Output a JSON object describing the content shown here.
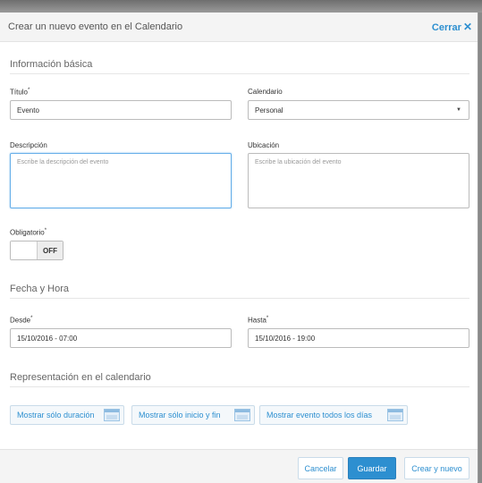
{
  "modal": {
    "title": "Crear un nuevo evento en el Calendario",
    "close_label": "Cerrar",
    "close_icon": "✕"
  },
  "basic": {
    "section_title": "Información básica",
    "title_label": "Título",
    "title_value": "Evento",
    "calendar_label": "Calendario",
    "calendar_value": "Personal",
    "description_label": "Descripción",
    "description_placeholder": "Escribe la descripción del evento",
    "location_label": "Ubicación",
    "location_placeholder": "Escribe la ubicación del evento",
    "required_label": "Obligatorio",
    "required_state": "OFF",
    "required_marker": "*"
  },
  "datetime": {
    "section_title": "Fecha y Hora",
    "from_label": "Desde",
    "from_value": "15/10/2016 - 07:00",
    "to_label": "Hasta",
    "to_value": "15/10/2016 - 19:00"
  },
  "representation": {
    "section_title": "Representación en el calendario",
    "buttons": [
      {
        "label": "Mostrar sólo duración",
        "icon": "calendar-duration-icon"
      },
      {
        "label": "Mostrar sólo inicio y fin",
        "icon": "calendar-start-end-icon"
      },
      {
        "label": "Mostrar evento todos los días",
        "icon": "calendar-all-days-icon"
      }
    ]
  },
  "footer": {
    "cancel_label": "Cancelar",
    "save_label": "Guardar",
    "save_new_label": "Crear y nuevo"
  },
  "colors": {
    "accent": "#2d8fd0",
    "header_bg": "#f4f4f4",
    "overlay": "#8a8a8a"
  }
}
